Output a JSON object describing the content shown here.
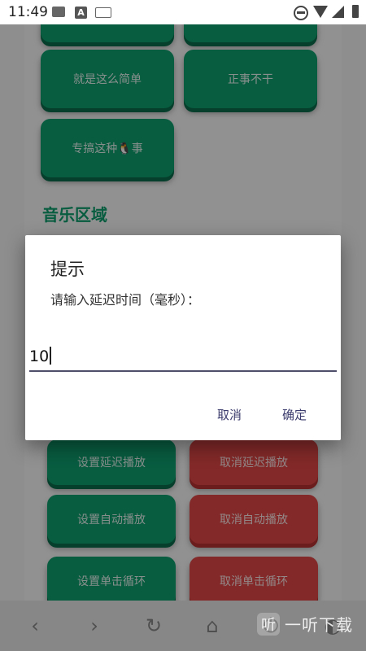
{
  "status_bar": {
    "time": "11:49",
    "left_icons": [
      "image-icon",
      "a-icon",
      "keyboard-icon"
    ],
    "right_icons": [
      "do-not-disturb-icon",
      "wifi-icon",
      "signal-icon",
      "battery-icon"
    ]
  },
  "buttons_top": [
    {
      "label": "就是这么简单"
    },
    {
      "label": "正事不干"
    },
    {
      "label": "专搞这种🐧事"
    }
  ],
  "music_section": {
    "title": "音乐区域",
    "buttons": [
      {
        "label": "设置延迟播放",
        "color": "green"
      },
      {
        "label": "取消延迟播放",
        "color": "red"
      },
      {
        "label": "设置自动播放",
        "color": "green"
      },
      {
        "label": "取消自动播放",
        "color": "red"
      },
      {
        "label": "设置单击循环",
        "color": "green"
      },
      {
        "label": "取消单击循环",
        "color": "red"
      }
    ]
  },
  "dialog": {
    "title": "提示",
    "message": "请输入延迟时间（毫秒）：",
    "input_value": "10",
    "cancel_label": "取消",
    "confirm_label": "确定"
  },
  "toolbar": {
    "icons": [
      "back-icon",
      "forward-icon",
      "refresh-icon",
      "home-icon",
      "power-icon",
      "toggle-icon"
    ]
  },
  "watermark": {
    "logo_char": "听",
    "text": "一听下载"
  },
  "colors": {
    "green": "#0e9f6e",
    "red": "#e24848",
    "dialog_button": "#3b3b6d"
  }
}
